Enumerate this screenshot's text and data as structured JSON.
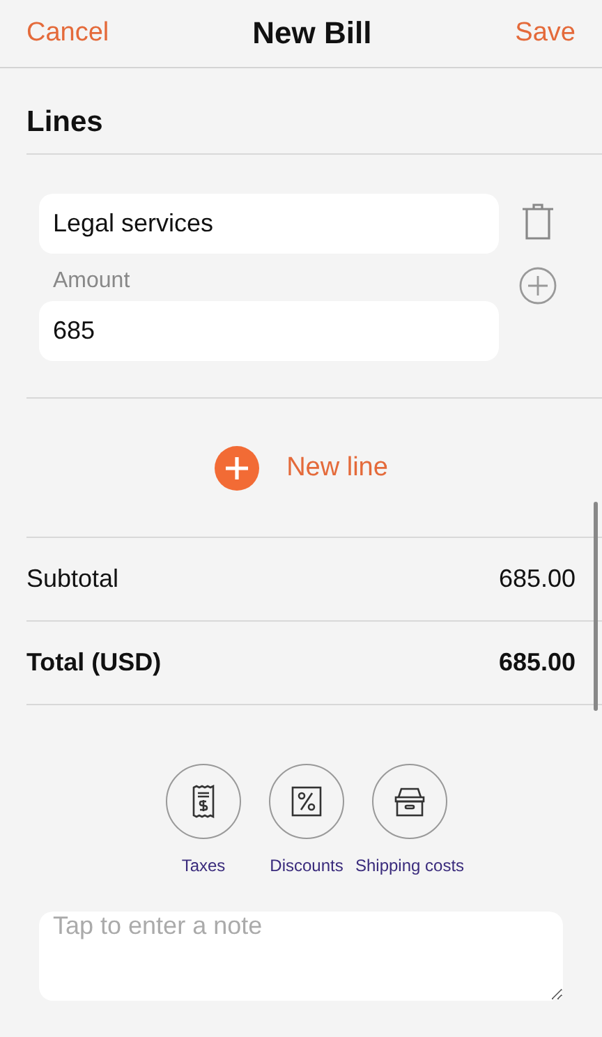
{
  "nav": {
    "cancel": "Cancel",
    "title": "New Bill",
    "save": "Save"
  },
  "section": {
    "title": "Lines"
  },
  "lines": [
    {
      "description": "Legal services",
      "amount_label": "Amount",
      "amount": "685"
    }
  ],
  "new_line": {
    "label": "New line"
  },
  "totals": [
    {
      "label": "Subtotal",
      "value": "685.00",
      "bold": false
    },
    {
      "label": "Total (USD)",
      "value": "685.00",
      "bold": true
    }
  ],
  "actions": [
    {
      "label": "Taxes"
    },
    {
      "label": "Discounts"
    },
    {
      "label": "Shipping costs"
    }
  ],
  "note": {
    "placeholder": "Tap to enter a note"
  }
}
